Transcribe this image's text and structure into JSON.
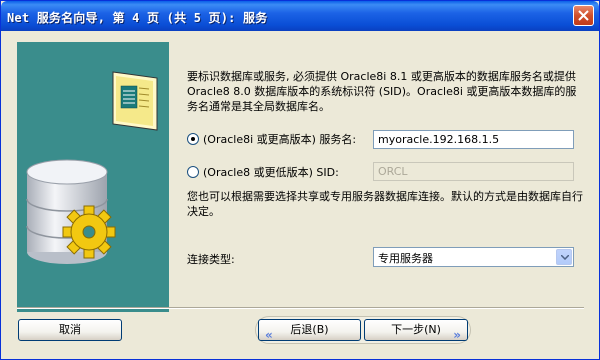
{
  "window": {
    "title": "Net 服务名向导, 第 4 页 (共 5 页): 服务"
  },
  "description": "要标识数据库或服务, 必须提供 Oracle8i 8.1 或更高版本的数据库服务名或提供 Oracle8 8.0 数据库版本的系统标识符 (SID)。Oracle8i 或更高版本数据库的服务名通常是其全局数据库名。",
  "options": {
    "service_name_label": "(Oracle8i 或更高版本) 服务名:",
    "service_name_value": "myoracle.192.168.1.5",
    "service_name_selected": true,
    "sid_label": "(Oracle8 或更低版本) SID:",
    "sid_value": "ORCL",
    "sid_selected": false
  },
  "connection_hint": "您也可以根据需要选择共享或专用服务器数据库连接。默认的方式是由数据库自行决定。",
  "connection": {
    "label": "连接类型:",
    "selected": "专用服务器"
  },
  "buttons": {
    "cancel": "取消",
    "back": "后退(B)",
    "next": "下一步(N)"
  },
  "colors": {
    "title_bar": "#0a4ed6",
    "art_background": "#3a8d8c",
    "dialog_background": "#ece9d8"
  }
}
